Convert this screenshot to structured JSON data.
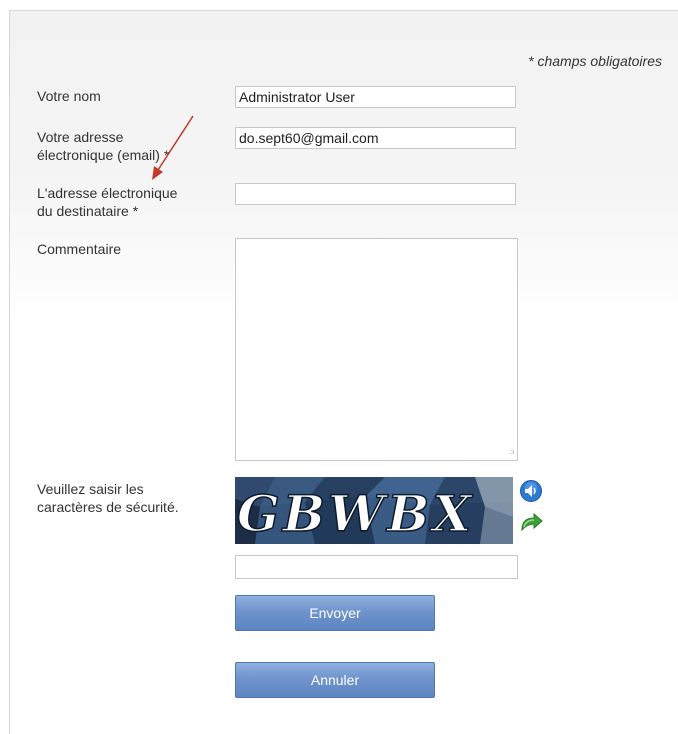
{
  "form": {
    "required_note": "* champs obligatoires",
    "name": {
      "label": "Votre nom",
      "value": "Administrator User"
    },
    "email": {
      "label_line1": "Votre adresse",
      "label_line2": "électronique (email) *",
      "value": "do.sept60@gmail.com"
    },
    "recipient": {
      "label_line1": "L'adresse électronique",
      "label_line2": "du destinataire *",
      "value": ""
    },
    "comment": {
      "label": "Commentaire",
      "value": ""
    },
    "captcha": {
      "label_line1": "Veuillez saisir les",
      "label_line2": "caractères de sécurité.",
      "image_text": "GBWBX",
      "audio_icon": "speaker-icon",
      "refresh_icon": "refresh-icon",
      "input_value": ""
    },
    "submit_label": "Envoyer",
    "cancel_label": "Annuler"
  },
  "colors": {
    "button": "#6f94cc",
    "annotation_arrow": "#c0392b",
    "captcha_bg": "#203048"
  }
}
